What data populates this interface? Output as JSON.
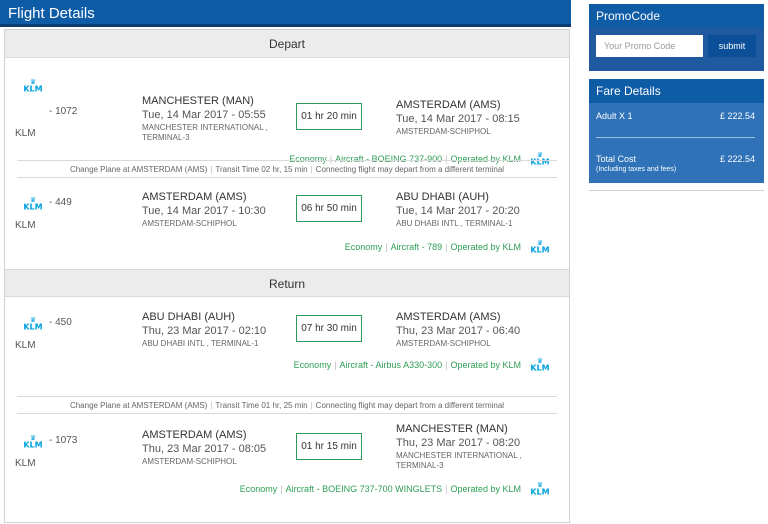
{
  "page_title": "Flight Details",
  "sections": {
    "depart": "Depart",
    "return": "Return"
  },
  "segments": [
    {
      "airline_logo": "KLM",
      "flight_number": "- 1072",
      "airline": "KLM",
      "from_city": "MANCHESTER (MAN)",
      "from_datetime": "Tue, 14 Mar 2017 - 05:55",
      "from_airport_line1": "MANCHESTER INTERNATIONAL ,",
      "from_airport_line2": "TERMINAL-3",
      "duration": "01 hr 20 min",
      "to_city": "AMSTERDAM (AMS)",
      "to_datetime": "Tue, 14 Mar 2017 - 08:15",
      "to_airport_line1": "AMSTERDAM-SCHIPHOL",
      "to_airport_line2": "",
      "cabin": "Economy",
      "aircraft": "Aircraft - BOEING 737-900",
      "operated_by": "Operated by KLM"
    },
    {
      "airline_logo": "KLM",
      "flight_number": "- 449",
      "airline": "KLM",
      "from_city": "AMSTERDAM (AMS)",
      "from_datetime": "Tue, 14 Mar 2017 - 10:30",
      "from_airport_line1": "AMSTERDAM-SCHIPHOL",
      "from_airport_line2": "",
      "duration": "06 hr 50 min",
      "to_city": "ABU DHABI (AUH)",
      "to_datetime": "Tue, 14 Mar 2017 - 20:20",
      "to_airport_line1": "ABU DHABI INTL , TERMINAL-1",
      "to_airport_line2": "",
      "cabin": "Economy",
      "aircraft": "Aircraft - 789",
      "operated_by": "Operated by KLM"
    },
    {
      "airline_logo": "KLM",
      "flight_number": "- 450",
      "airline": "KLM",
      "from_city": "ABU DHABI (AUH)",
      "from_datetime": "Thu, 23 Mar 2017 - 02:10",
      "from_airport_line1": "ABU DHABI INTL , TERMINAL-1",
      "from_airport_line2": "",
      "duration": "07 hr 30 min",
      "to_city": "AMSTERDAM (AMS)",
      "to_datetime": "Thu, 23 Mar 2017 - 06:40",
      "to_airport_line1": "AMSTERDAM-SCHIPHOL",
      "to_airport_line2": "",
      "cabin": "Economy",
      "aircraft": "Aircraft - Airbus A330-300",
      "operated_by": "Operated by KLM"
    },
    {
      "airline_logo": "KLM",
      "flight_number": "- 1073",
      "airline": "KLM",
      "from_city": "AMSTERDAM (AMS)",
      "from_datetime": "Thu, 23 Mar 2017 - 08:05",
      "from_airport_line1": "AMSTERDAM-SCHIPHOL",
      "from_airport_line2": "",
      "duration": "01 hr 15 min",
      "to_city": "MANCHESTER (MAN)",
      "to_datetime": "Thu, 23 Mar 2017 - 08:20",
      "to_airport_line1": "MANCHESTER INTERNATIONAL ,",
      "to_airport_line2": "TERMINAL-3",
      "cabin": "Economy",
      "aircraft": "Aircraft - BOEING 737-700 WINGLETS",
      "operated_by": "Operated by KLM"
    }
  ],
  "connections": [
    {
      "change": "Change Plane at AMSTERDAM (AMS)",
      "transit": "Transit Time 02 hr, 15 min",
      "note": "Connecting flight may depart from a different terminal"
    },
    {
      "change": "Change Plane at AMSTERDAM (AMS)",
      "transit": "Transit Time 01 hr, 25 min",
      "note": "Connecting flight may depart from a different terminal"
    }
  ],
  "promo": {
    "title": "PromoCode",
    "placeholder": "Your Promo Code",
    "value": "",
    "submit_label": "submit"
  },
  "fare": {
    "title": "Fare Details",
    "adult_label": "Adult X 1",
    "adult_amount": "£ 222.54",
    "total_label": "Total Cost",
    "total_note": "(Including taxes and fees)",
    "total_amount": "£ 222.54"
  },
  "colors": {
    "header_blue": "#0e5ba6",
    "fare_blue": "#2f72b8",
    "meta_green": "#2e9e55",
    "klm_blue": "#00a1de"
  },
  "icons": {
    "airline_logo": "klm-crown-logo"
  }
}
